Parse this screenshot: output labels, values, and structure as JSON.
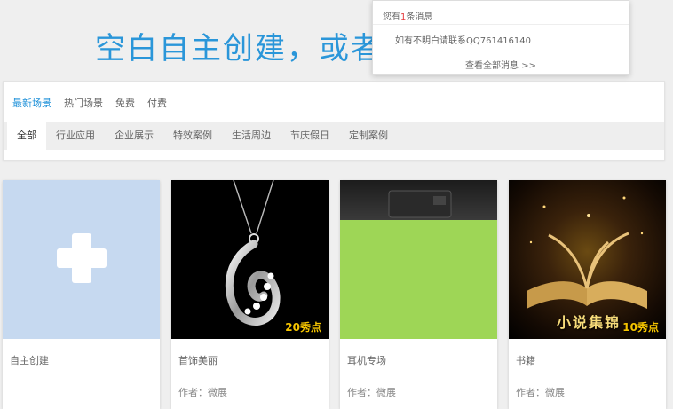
{
  "hero": {
    "title": "空白自主创建，或者"
  },
  "filters": {
    "primary": [
      "最新场景",
      "热门场景",
      "免费",
      "付费"
    ],
    "sub": [
      "全部",
      "行业应用",
      "企业展示",
      "特效案例",
      "生活周边",
      "节庆假日",
      "定制案例"
    ]
  },
  "cards": [
    {
      "name": "自主创建",
      "author": ""
    },
    {
      "name": "首饰美丽",
      "author": "作者：微展",
      "price": "20秀点"
    },
    {
      "name": "耳机专场",
      "author": "作者：微展"
    },
    {
      "name": "书籍",
      "author": "作者：微展",
      "price": "10秀点",
      "book_title": "小说集锦"
    }
  ],
  "notification": {
    "head_prefix": "您有",
    "count": "1",
    "head_suffix": "条消息",
    "message": "如有不明白请联系QQ761416140",
    "more": "查看全部消息 >>"
  },
  "colors": {
    "accent": "#1b8fd8",
    "hero": "#2a96d9",
    "create_card": "#c6d9f0",
    "headphone_card": "#9ed656",
    "price": "#f5c400"
  }
}
